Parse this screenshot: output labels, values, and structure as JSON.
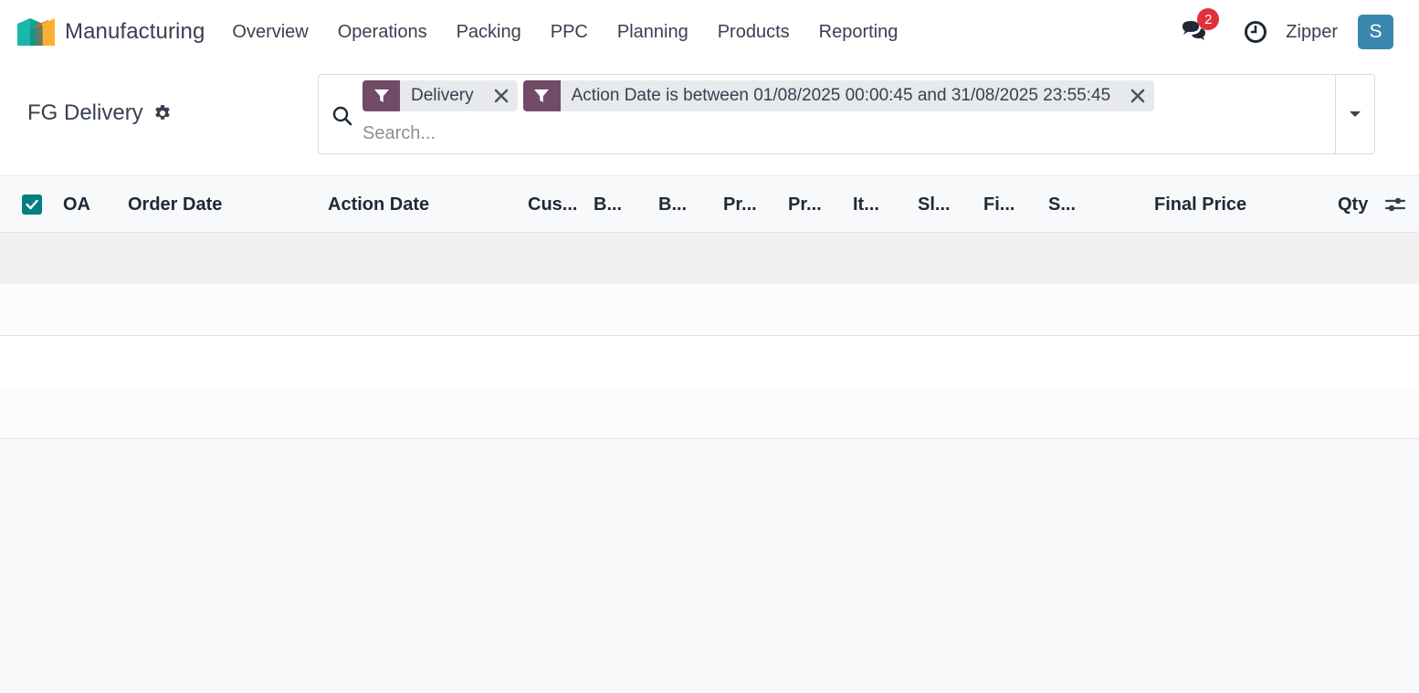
{
  "navbar": {
    "app_name": "Manufacturing",
    "menu": [
      "Overview",
      "Operations",
      "Packing",
      "PPC",
      "Planning",
      "Products",
      "Reporting"
    ],
    "messages_badge": "2",
    "company": "Zipper",
    "avatar_initial": "S"
  },
  "control_panel": {
    "title": "FG Delivery",
    "facets": [
      {
        "label": "Delivery"
      },
      {
        "label": "Action Date is between 01/08/2025 00:00:45 and 31/08/2025 23:55:45"
      }
    ],
    "search_placeholder": "Search..."
  },
  "list": {
    "columns": [
      "OA",
      "Order Date",
      "Action Date",
      "Cus...",
      "B...",
      "B...",
      "Pr...",
      "Pr...",
      "It...",
      "Sl...",
      "Fi...",
      "S...",
      "Final Price",
      "Qty"
    ],
    "rows": []
  },
  "colors": {
    "brand_accent": "#714b67",
    "checkbox": "#017e84",
    "badge": "#e0303c",
    "avatar": "#3a87ad"
  }
}
